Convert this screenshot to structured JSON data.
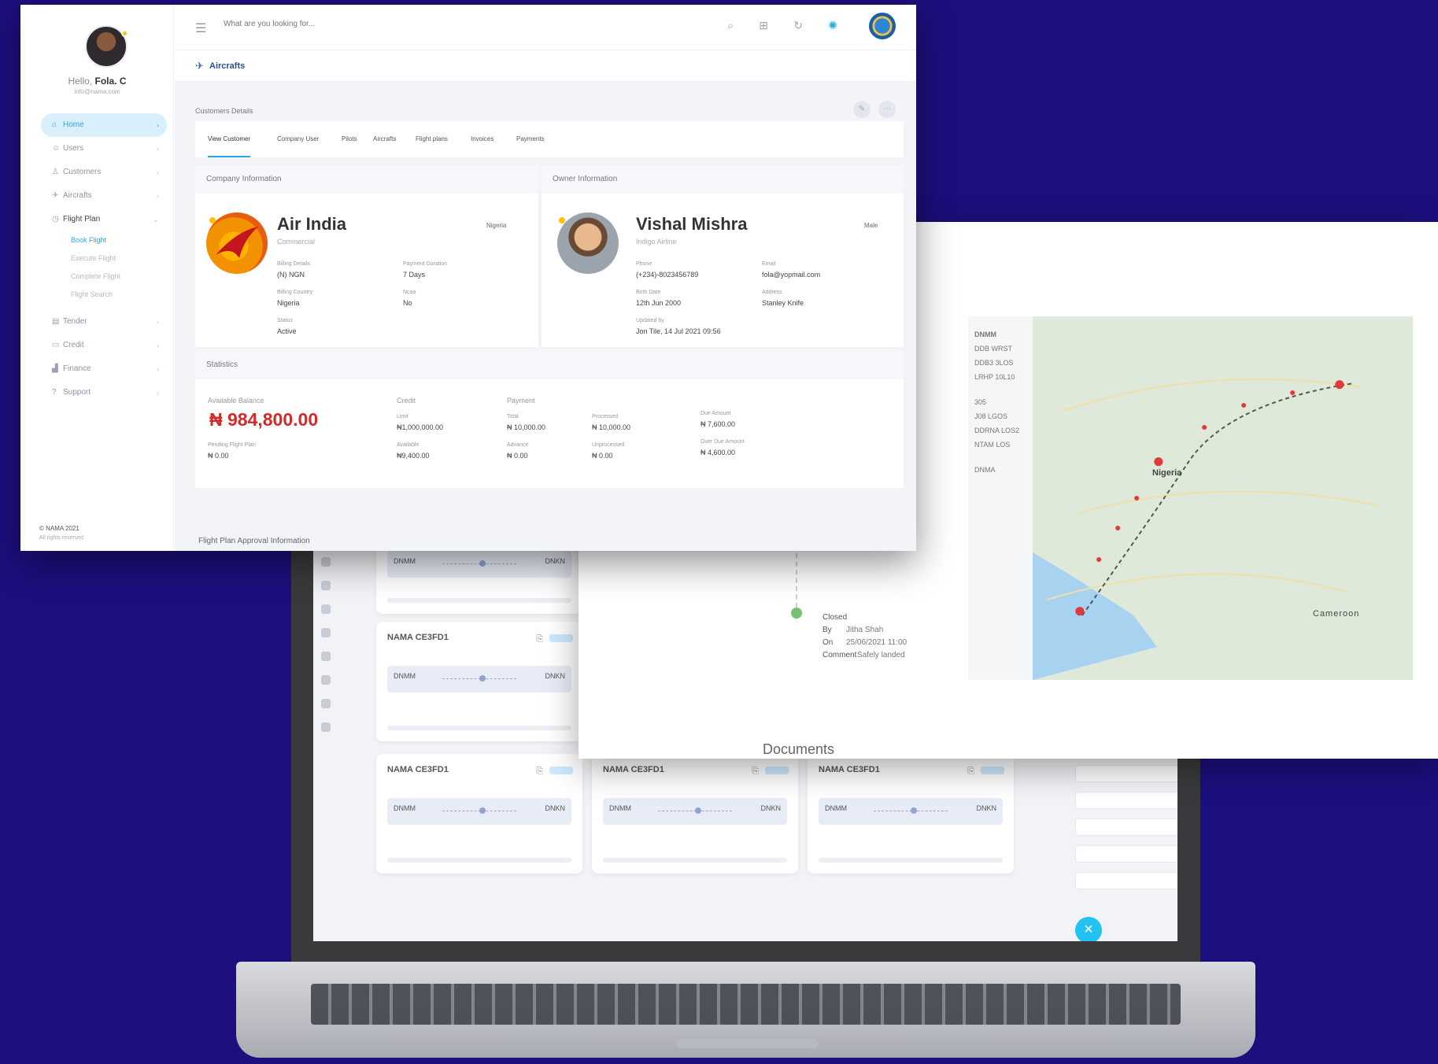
{
  "app": {
    "user": {
      "greeting": "Hello,",
      "name": "Fola. C",
      "email": "info@nama.com"
    },
    "nav": [
      {
        "label": "Home",
        "icon": "home-icon",
        "active": true
      },
      {
        "label": "Users",
        "icon": "users-icon"
      },
      {
        "label": "Customers",
        "icon": "customer-icon"
      },
      {
        "label": "Aircrafts",
        "icon": "plane-icon"
      },
      {
        "label": "Flight Plan",
        "icon": "clock-icon",
        "open": true
      },
      {
        "label": "Tender",
        "icon": "doc-icon"
      },
      {
        "label": "Credit",
        "icon": "card-icon"
      },
      {
        "label": "Finance",
        "icon": "chart-icon"
      },
      {
        "label": "Support",
        "icon": "help-icon"
      }
    ],
    "subnav": [
      "Book Flight",
      "Execute Flight",
      "Complete Flight",
      "Flight Search"
    ],
    "copyright": {
      "line1": "© NAMA 2021",
      "line2": "All rights reserved"
    },
    "search_placeholder": "What are you looking for...",
    "breadcrumb": "Aircrafts",
    "section_title": "Customers Details",
    "tabs": [
      "View Customer",
      "Company User",
      "Pilots",
      "Aircrafts",
      "Flight plans",
      "Invoices",
      "Payments"
    ],
    "company": {
      "header": "Company Information",
      "name": "Air India",
      "type": "Commercial",
      "country": "Nigeria",
      "fields": [
        {
          "label": "Billing Details",
          "value": "(N) NGN"
        },
        {
          "label": "Payment Duration",
          "value": "7 Days"
        },
        {
          "label": "Billing Country",
          "value": "Nigeria"
        },
        {
          "label": "Ncaa",
          "value": "No"
        },
        {
          "label": "Status",
          "value": "Active"
        }
      ]
    },
    "owner": {
      "header": "Owner Information",
      "name": "Vishal Mishra",
      "company": "Indigo Airline",
      "gender": "Male",
      "fields": [
        {
          "label": "Phone",
          "value": "(+234)-8023456789"
        },
        {
          "label": "Email",
          "value": "fola@yopmail.com"
        },
        {
          "label": "Birth Date",
          "value": "12th Jun 2000"
        },
        {
          "label": "Address",
          "value": "Stanley Knife"
        },
        {
          "label": "Updated by",
          "value": "Jon Tile, 14 Jul 2021 09:56"
        }
      ]
    },
    "stats": {
      "header": "Statistics",
      "balance_label": "Available Balance",
      "balance": "₦ 984,800.00",
      "pending_label": "Pending Flight Plan",
      "pending": "₦ 0.00",
      "credit": {
        "label": "Credit",
        "limit_label": "Limit",
        "limit": "₦1,000,000.00",
        "available_label": "Available",
        "available": "₦9,400.00"
      },
      "payment": {
        "label": "Payment",
        "total_label": "Total",
        "total": "₦ 10,000.00",
        "advance_label": "Advance",
        "advance": "₦ 0.00",
        "processed_label": "Processed",
        "processed": "₦ 10,000.00",
        "unprocessed_label": "Unprocessed",
        "unprocessed": "₦ 0.00",
        "due_label": "Due Amount",
        "due": "₦ 7,600.00",
        "overdue_label": "Over Due Amount",
        "overdue": "₦ 4,600.00"
      }
    },
    "flight_plan_title": "Flight Plan Approval Information"
  },
  "map_panel": {
    "timeline": {
      "status": "Closed",
      "by_label": "By",
      "by": "Jitha Shah",
      "on_label": "On",
      "on": "25/06/2021 11:00",
      "comment_label": "Comment",
      "comment": "Safely landed"
    },
    "documents": "Documents",
    "map_labels": {
      "country": "Nigeria",
      "neighbor": "Cameroon"
    },
    "map_side": [
      "DNMM",
      "DDB WRST",
      "DDB3 3LOS",
      "LRHP 10L10",
      "305",
      "J08 LGOS",
      "DDRNA LOS2",
      "NTAM LOS",
      "DNMA"
    ]
  },
  "laptop": {
    "card_title": "NAMA CE3FD1",
    "card_from": "DNMM",
    "card_to": "DNKN"
  },
  "colors": {
    "background": "#1c0f7e",
    "accent": "#2ba7e5",
    "balance": "#d42a2a",
    "map_pin": "#e03b3b"
  }
}
